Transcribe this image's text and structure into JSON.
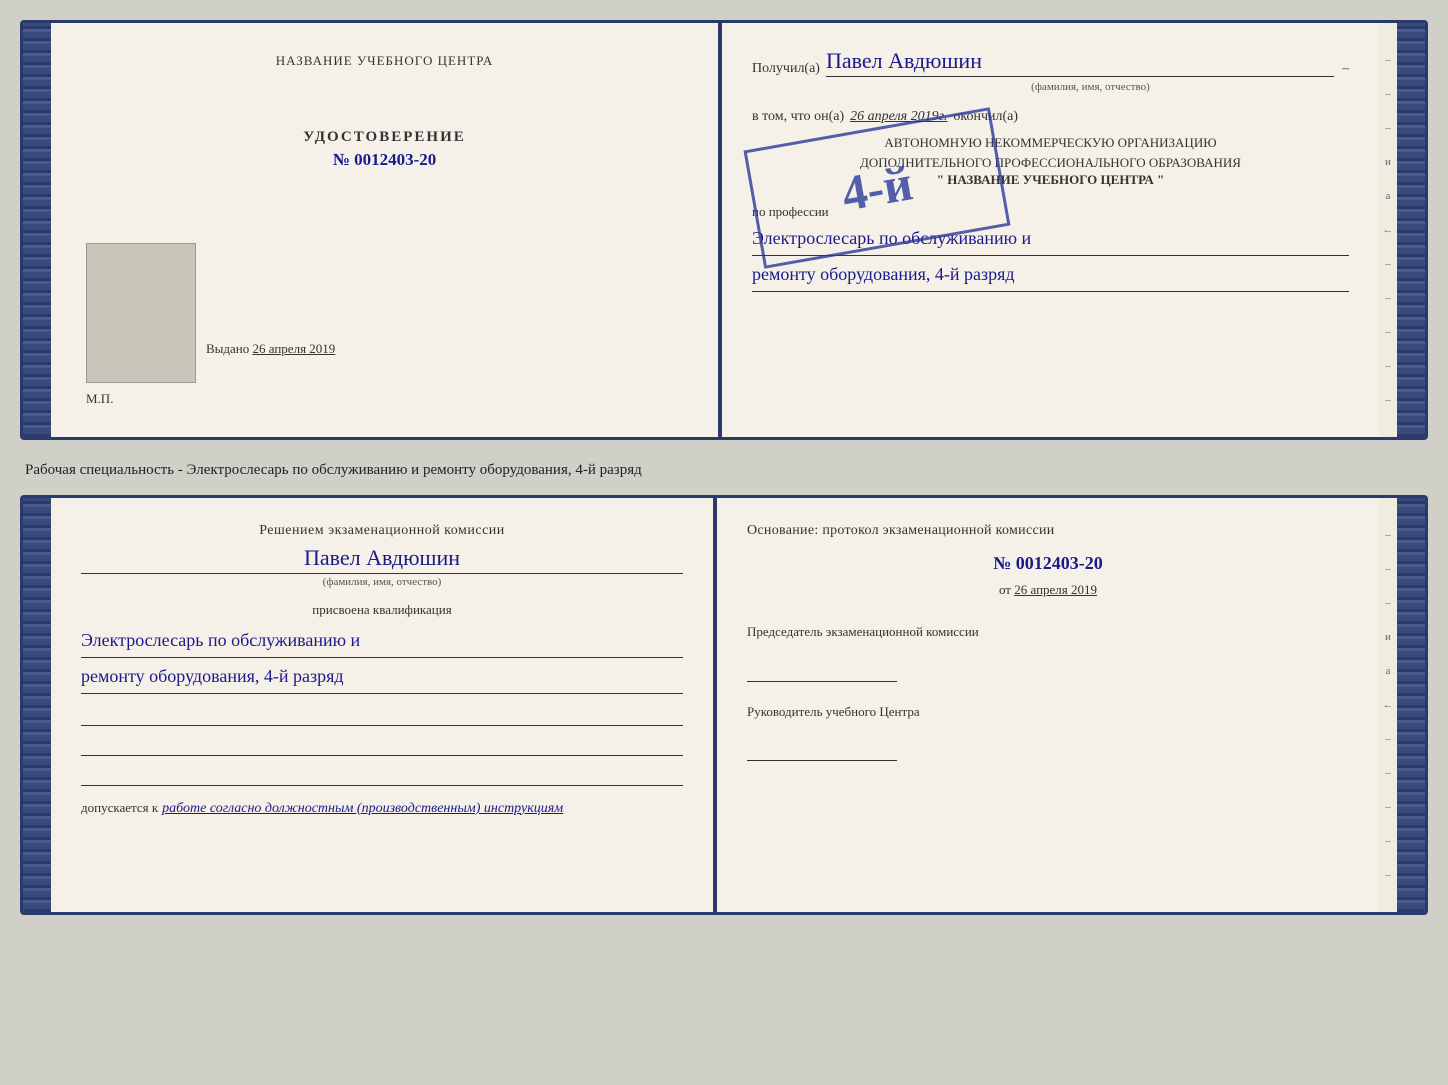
{
  "doc_top": {
    "left": {
      "training_center_label": "НАЗВАНИЕ УЧЕБНОГО ЦЕНТРА",
      "udostoverenie_label": "УДОСТОВЕРЕНИЕ",
      "number": "№ 0012403-20",
      "vydano_label": "Выдано",
      "vydano_date": "26 апреля 2019",
      "mp_label": "М.П."
    },
    "right": {
      "poluchil_label": "Получил(а)",
      "poluchil_name": "Павел Авдюшин",
      "fio_subtitle": "(фамилия, имя, отчество)",
      "dash": "–",
      "vtom_label": "в том, что он(а)",
      "vtom_date": "26 апреля 2019г.",
      "okonchil_label": "окончил(а)",
      "org_line1": "АВТОНОМНУЮ НЕКОММЕРЧЕСКУЮ ОРГАНИЗАЦИЮ",
      "org_line2": "ДОПОЛНИТЕЛЬНОГО ПРОФЕССИОНАЛЬНОГО ОБРАЗОВАНИЯ",
      "org_name": "\" НАЗВАНИЕ УЧЕБНОГО ЦЕНТРА \"",
      "po_professii_label": "по профессии",
      "professiya_line1": "Электрослесарь по обслуживанию и",
      "professiya_line2": "ремонту оборудования, 4-й разряд",
      "rank_stamp": "4-й"
    }
  },
  "middle_text": "Рабочая специальность - Электрослесарь по обслуживанию и ремонту оборудования, 4-й разряд",
  "doc_bottom": {
    "left": {
      "resheniem_label": "Решением экзаменационной комиссии",
      "name": "Павел Авдюшин",
      "fio_subtitle": "(фамилия, имя, отчество)",
      "prisvoena_label": "присвоена квалификация",
      "kvalif_line1": "Электрослесарь по обслуживанию и",
      "kvalif_line2": "ремонту оборудования, 4-й разряд",
      "dopusk_label": "допускается к",
      "dopusk_value": "работе согласно должностным (производственным) инструкциям"
    },
    "right": {
      "osnovanie_label": "Основание: протокол экзаменационной комиссии",
      "protocol_number": "№ 0012403-20",
      "ot_label": "от",
      "ot_date": "26 апреля 2019",
      "chairman_label": "Председатель экзаменационной комиссии",
      "rukovod_label": "Руководитель учебного Центра"
    }
  },
  "edge_deco": {
    "chars": [
      "–",
      "–",
      "–",
      "–",
      "и",
      "а",
      "←",
      "–",
      "–",
      "–",
      "–",
      "–"
    ]
  }
}
